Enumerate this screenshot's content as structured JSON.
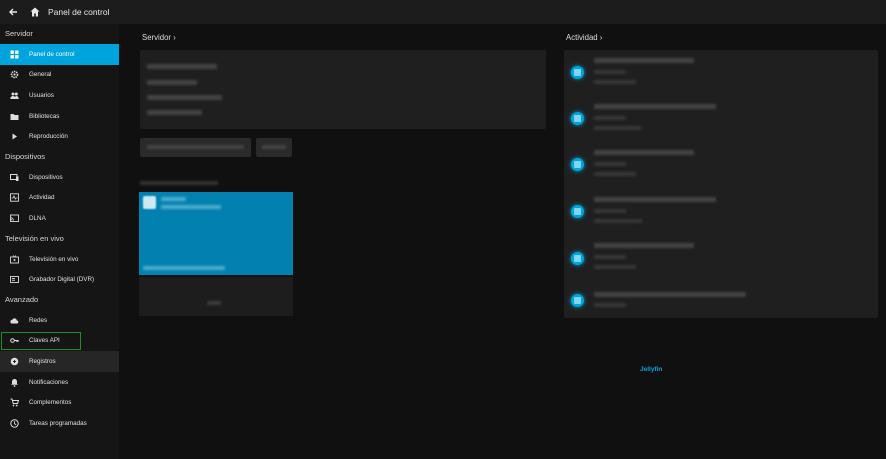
{
  "header": {
    "title": "Panel de control"
  },
  "sidebar": {
    "sections": [
      {
        "label": "Servidor",
        "items": [
          {
            "label": "Panel de control",
            "icon": "dashboard-icon",
            "state": "active"
          },
          {
            "label": "General",
            "icon": "gear-icon"
          },
          {
            "label": "Usuarios",
            "icon": "users-icon"
          },
          {
            "label": "Bibliotecas",
            "icon": "folder-icon"
          },
          {
            "label": "Reproducción",
            "icon": "play-icon"
          }
        ]
      },
      {
        "label": "Dispositivos",
        "items": [
          {
            "label": "Dispositivos",
            "icon": "devices-icon"
          },
          {
            "label": "Actividad",
            "icon": "pulse-icon"
          },
          {
            "label": "DLNA",
            "icon": "cast-icon"
          }
        ]
      },
      {
        "label": "Televisión en vivo",
        "items": [
          {
            "label": "Televisión en vivo",
            "icon": "tv-icon"
          },
          {
            "label": "Grabador Digital (DVR)",
            "icon": "dvr-icon"
          }
        ]
      },
      {
        "label": "Avanzado",
        "items": [
          {
            "label": "Redes",
            "icon": "cloud-icon"
          },
          {
            "label": "Claves API",
            "icon": "key-icon",
            "state": "boxed"
          },
          {
            "label": "Registros",
            "icon": "log-icon",
            "state": "hover"
          },
          {
            "label": "Notificaciones",
            "icon": "bell-icon"
          },
          {
            "label": "Complementos",
            "icon": "cart-icon"
          },
          {
            "label": "Tareas programadas",
            "icon": "clock-icon"
          }
        ]
      }
    ]
  },
  "main": {
    "server_title": "Servidor ›",
    "activity_title": "Actividad ›",
    "footer_link": "Jellyfin"
  },
  "colors": {
    "accent": "#00a4dc",
    "highlight_box": "#1f8f23"
  }
}
